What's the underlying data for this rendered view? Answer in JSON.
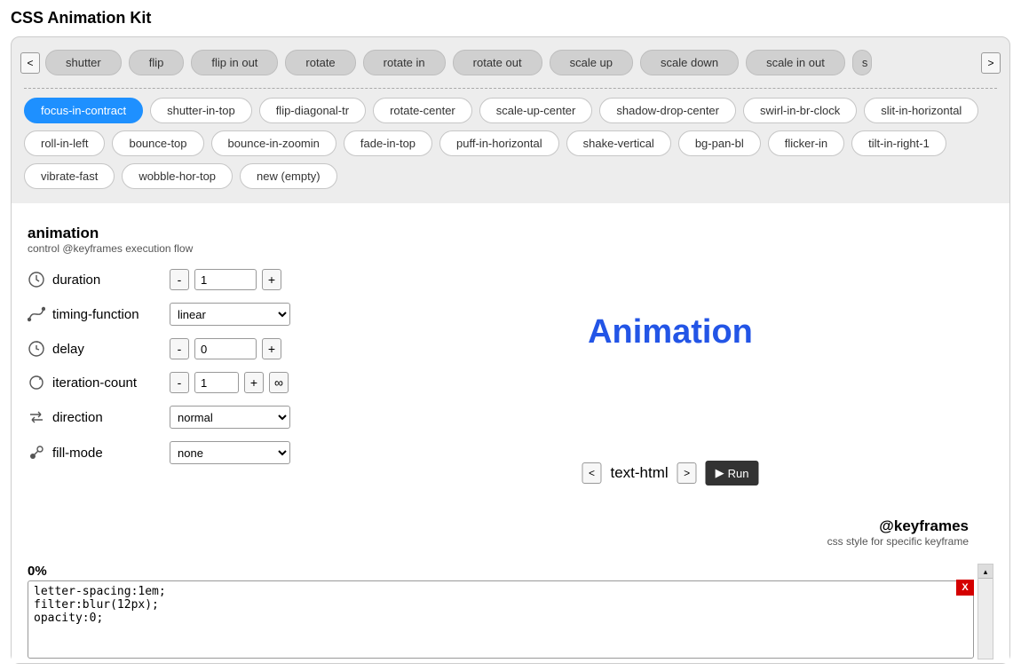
{
  "page_title": "CSS Animation Kit",
  "nav_prev": "<",
  "nav_next": ">",
  "tabs": [
    "shutter",
    "flip",
    "flip in out",
    "rotate",
    "rotate in",
    "rotate out",
    "scale up",
    "scale down",
    "scale in out"
  ],
  "pills": [
    {
      "label": "focus-in-contract",
      "active": true
    },
    {
      "label": "shutter-in-top",
      "active": false
    },
    {
      "label": "flip-diagonal-tr",
      "active": false
    },
    {
      "label": "rotate-center",
      "active": false
    },
    {
      "label": "scale-up-center",
      "active": false
    },
    {
      "label": "shadow-drop-center",
      "active": false
    },
    {
      "label": "swirl-in-br-clock",
      "active": false
    },
    {
      "label": "slit-in-horizontal",
      "active": false
    },
    {
      "label": "roll-in-left",
      "active": false
    },
    {
      "label": "bounce-top",
      "active": false
    },
    {
      "label": "bounce-in-zoomin",
      "active": false
    },
    {
      "label": "fade-in-top",
      "active": false
    },
    {
      "label": "puff-in-horizontal",
      "active": false
    },
    {
      "label": "shake-vertical",
      "active": false
    },
    {
      "label": "bg-pan-bl",
      "active": false
    },
    {
      "label": "flicker-in",
      "active": false
    },
    {
      "label": "tilt-in-right-1",
      "active": false
    },
    {
      "label": "vibrate-fast",
      "active": false
    },
    {
      "label": "wobble-hor-top",
      "active": false
    },
    {
      "label": "new (empty)",
      "active": false
    }
  ],
  "anim_section": {
    "title": "animation",
    "subtitle": "control @keyframes execution flow"
  },
  "props": {
    "duration_label": "duration",
    "duration_value": "1",
    "timing_label": "timing-function",
    "timing_value": "linear",
    "delay_label": "delay",
    "delay_value": "0",
    "iteration_label": "iteration-count",
    "iteration_value": "1",
    "direction_label": "direction",
    "direction_value": "normal",
    "fillmode_label": "fill-mode",
    "fillmode_value": "none"
  },
  "btn_minus": "-",
  "btn_plus": "+",
  "btn_inf": "∞",
  "preview": {
    "text": "Animation",
    "mode_label": "text-html",
    "run_label": "Run",
    "prev": "<",
    "next": ">"
  },
  "keyframes_section": {
    "title": "@keyframes",
    "subtitle": "css style for specific keyframe"
  },
  "keyframe": {
    "percent": "0%",
    "css": "letter-spacing:1em;\nfilter:blur(12px);\nopacity:0;",
    "close": "X"
  },
  "scroll_up": "▴"
}
